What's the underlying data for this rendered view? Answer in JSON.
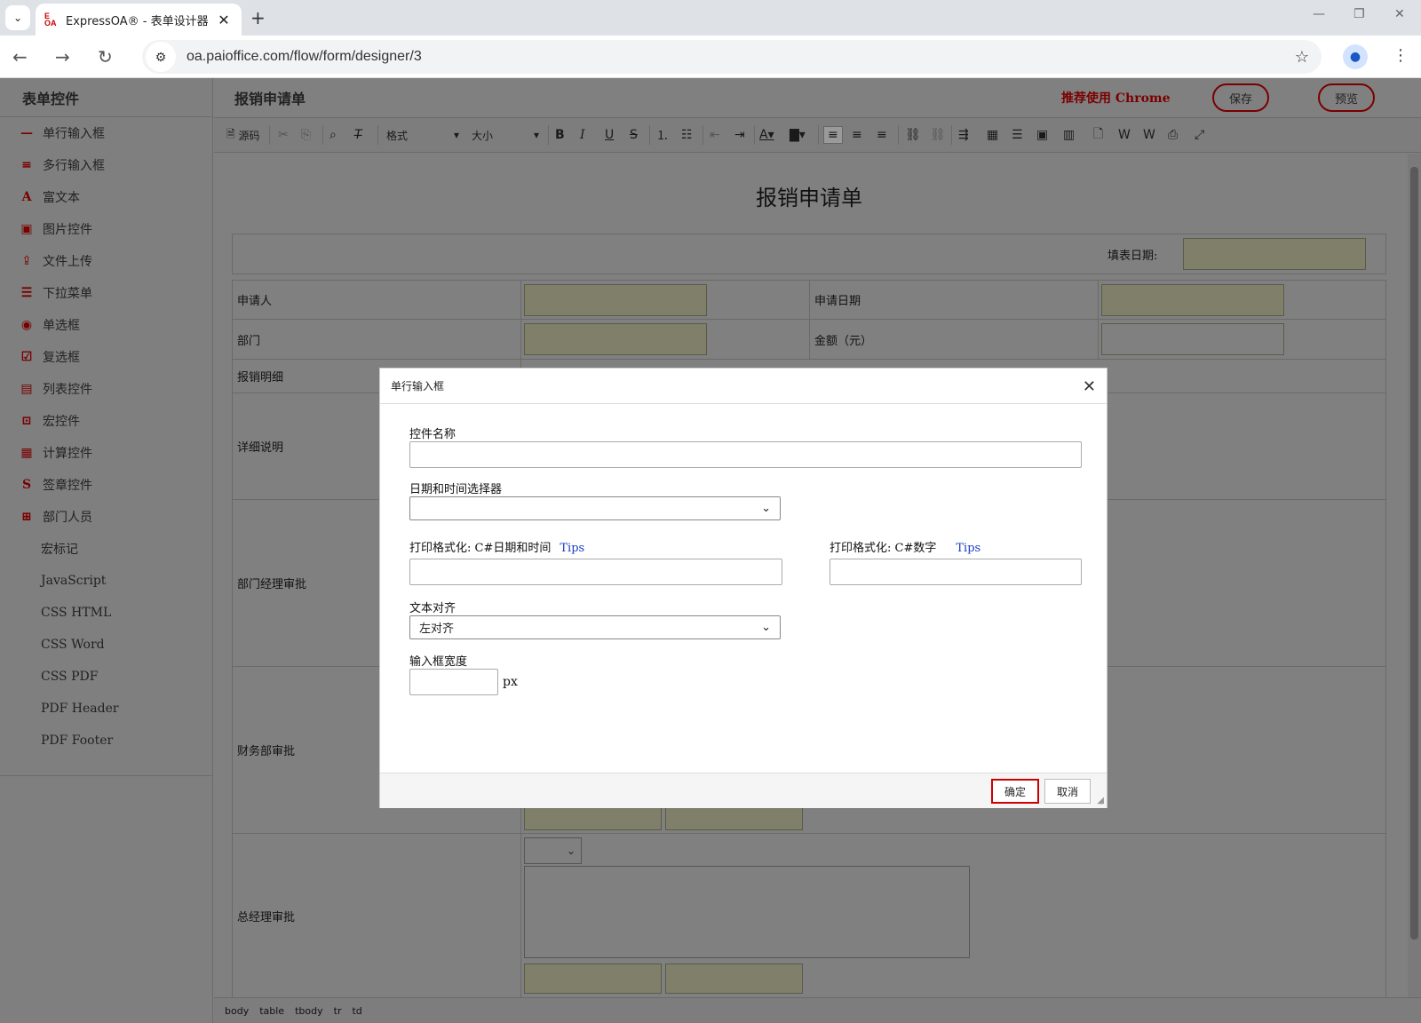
{
  "browser": {
    "tab_title": "ExpressOA® - 表单设计器",
    "favicon_text": "E OA",
    "url": "oa.paioffice.com/flow/form/designer/3"
  },
  "sidebar": {
    "title": "表单控件",
    "items": [
      {
        "label": "单行输入框",
        "icon": "single-line-icon"
      },
      {
        "label": "多行输入框",
        "icon": "multi-line-icon"
      },
      {
        "label": "富文本",
        "icon": "rich-text-icon"
      },
      {
        "label": "图片控件",
        "icon": "image-icon"
      },
      {
        "label": "文件上传",
        "icon": "file-upload-icon"
      },
      {
        "label": "下拉菜单",
        "icon": "dropdown-icon"
      },
      {
        "label": "单选框",
        "icon": "radio-icon"
      },
      {
        "label": "复选框",
        "icon": "checkbox-icon"
      },
      {
        "label": "列表控件",
        "icon": "list-icon"
      },
      {
        "label": "宏控件",
        "icon": "macro-icon"
      },
      {
        "label": "计算控件",
        "icon": "calculator-icon"
      },
      {
        "label": "签章控件",
        "icon": "signature-icon"
      },
      {
        "label": "部门人员",
        "icon": "department-icon"
      },
      {
        "label": "宏标记"
      },
      {
        "label": "JavaScript"
      },
      {
        "label": "CSS HTML"
      },
      {
        "label": "CSS Word"
      },
      {
        "label": "CSS PDF"
      },
      {
        "label": "PDF Header"
      },
      {
        "label": "PDF Footer"
      }
    ]
  },
  "header": {
    "form_name": "报销申请单",
    "chrome_tip": "推荐使用 Chrome",
    "save_label": "保存",
    "preview_label": "预览"
  },
  "toolbar": {
    "source_label": "源码",
    "format_label": "格式",
    "size_label": "大小"
  },
  "document": {
    "title": "报销申请单",
    "fill_date_label": "填表日期:",
    "applicant_label": "申请人",
    "apply_date_label": "申请日期",
    "department_label": "部门",
    "amount_label": "金额（元）",
    "detail_items_label": "报销明细",
    "description_label": "详细说明",
    "dept_manager_label": "部门经理审批",
    "finance_label": "财务部审批",
    "gm_label": "总经理审批"
  },
  "statusbar": [
    "body",
    "table",
    "tbody",
    "tr",
    "td"
  ],
  "dialog": {
    "title": "单行输入框",
    "control_name_label": "控件名称",
    "control_name_value": "",
    "picker_label": "日期和时间选择器",
    "picker_value": "",
    "print_datetime_label": "打印格式化: C#日期和时间",
    "print_number_label": "打印格式化: C#数字",
    "tips_label": "Tips",
    "align_label": "文本对齐",
    "align_value": "左对齐",
    "width_label": "输入框宽度",
    "width_unit": "px",
    "ok_label": "确定",
    "cancel_label": "取消"
  }
}
